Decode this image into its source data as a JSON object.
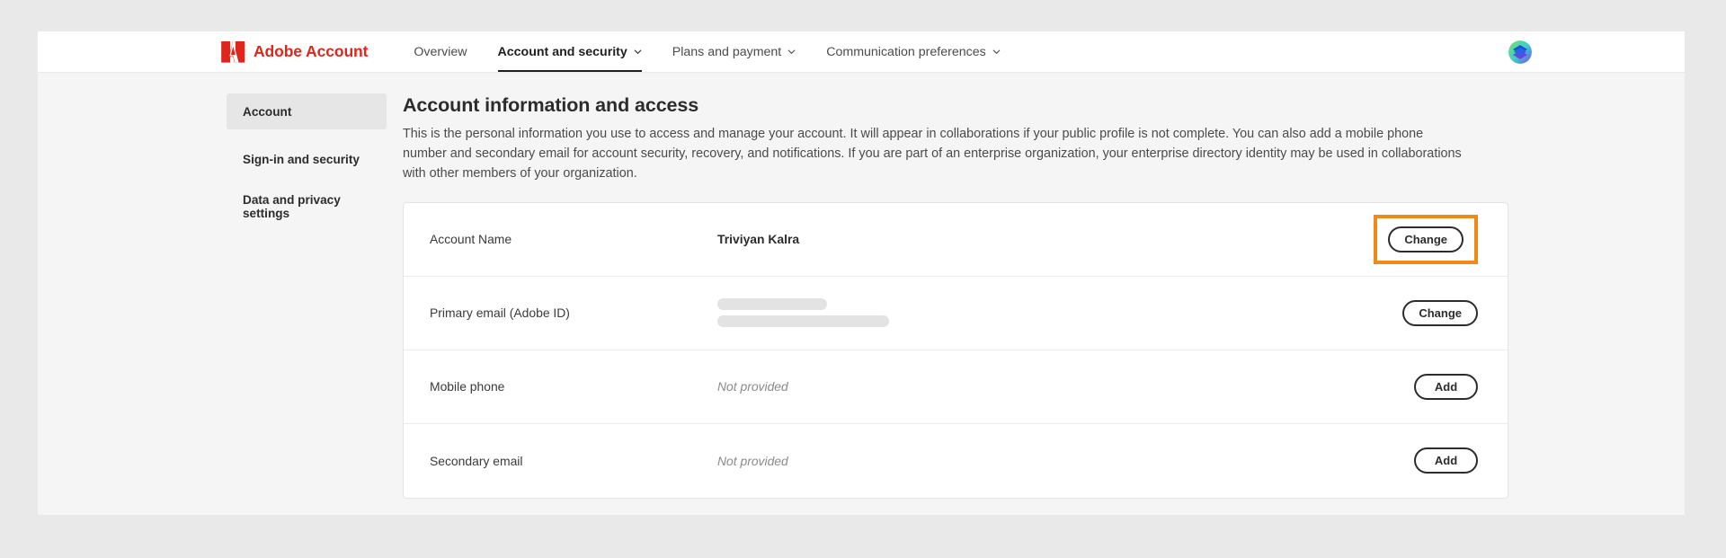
{
  "brand": {
    "logo_icon": "adobe-logo-icon",
    "name": "Adobe Account"
  },
  "topnav": {
    "items": [
      {
        "label": "Overview",
        "has_chevron": false,
        "active": false
      },
      {
        "label": "Account and security",
        "has_chevron": true,
        "active": true
      },
      {
        "label": "Plans and payment",
        "has_chevron": true,
        "active": false
      },
      {
        "label": "Communication preferences",
        "has_chevron": true,
        "active": false
      }
    ],
    "avatar_icon": "user-avatar-icon"
  },
  "sidebar": {
    "items": [
      {
        "label": "Account",
        "selected": true
      },
      {
        "label": "Sign-in and security",
        "selected": false
      },
      {
        "label": "Data and privacy settings",
        "selected": false
      }
    ]
  },
  "main": {
    "title": "Account information and access",
    "description": "This is the personal information you use to access and manage your account. It will appear in collaborations if your public profile is not complete. You can also add a mobile phone number and secondary email for account security, recovery, and notifications. If you are part of an enterprise organization, your enterprise directory identity may be used in collaborations with other members of your organization.",
    "rows": [
      {
        "label": "Account Name",
        "value": "Triviyan Kalra",
        "value_kind": "text",
        "action_label": "Change",
        "highlighted": true
      },
      {
        "label": "Primary email (Adobe ID)",
        "value": "",
        "value_kind": "redacted",
        "action_label": "Change",
        "highlighted": false
      },
      {
        "label": "Mobile phone",
        "value": "Not provided",
        "value_kind": "muted",
        "action_label": "Add",
        "highlighted": false
      },
      {
        "label": "Secondary email",
        "value": "Not provided",
        "value_kind": "muted",
        "action_label": "Add",
        "highlighted": false
      }
    ]
  },
  "colors": {
    "adobe_red": "#e1251b",
    "highlight_orange": "#ef8a16",
    "page_background": "#f5f5f5",
    "outer_background": "#e9e9e9"
  }
}
